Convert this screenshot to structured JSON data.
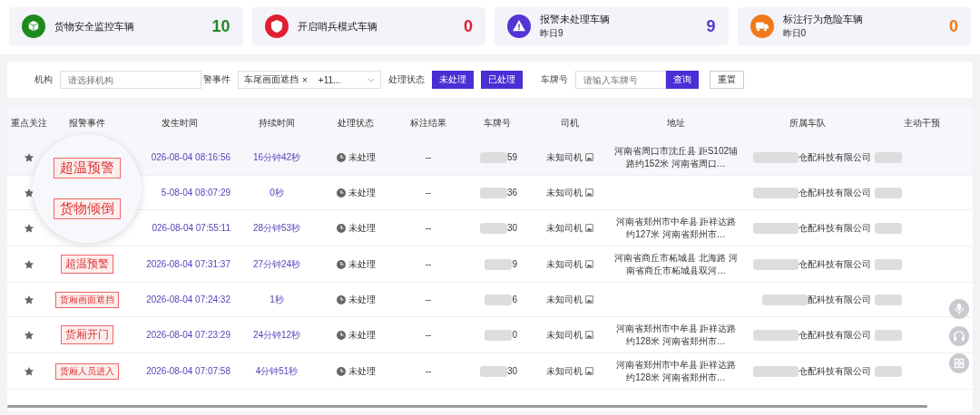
{
  "stat_cards": [
    {
      "color": "#1e8a1e",
      "title": "货物安全监控车辆",
      "value": "10"
    },
    {
      "color": "#e02030",
      "title": "开启哨兵模式车辆",
      "value": "0"
    },
    {
      "color": "#5335d6",
      "title": "报警未处理车辆",
      "sub": "昨日9",
      "value": "9"
    },
    {
      "color": "#f07a1a",
      "title": "标注行为危险车辆",
      "sub": "昨日0",
      "value": "0"
    }
  ],
  "filters": {
    "org_label": "机构",
    "org_placeholder": "请选择机构",
    "event_label": "警事件",
    "event_tag": "车尾画面遮挡",
    "event_tag_remove": "×",
    "event_more": "+11...",
    "status_label": "处理状态",
    "status_buttons": [
      {
        "label": "未处理",
        "selected": true
      },
      {
        "label": "已处理",
        "selected": true
      }
    ],
    "plate_label": "车牌号",
    "plate_placeholder": "请输入车牌号",
    "search": "查询",
    "reset": "重置"
  },
  "table": {
    "columns": [
      "重点关注",
      "报警事件",
      "发生时间",
      "持续时间",
      "处理状态",
      "标注结果",
      "车牌号",
      "司机",
      "地址",
      "所属车队",
      "主动干预"
    ],
    "rows": [
      {
        "time": "026-08-04 08:16:56",
        "duration": "16分钟42秒",
        "status": "未处理",
        "mark": "--",
        "plate": "59",
        "driver": "未知司机",
        "address": "河南省周口市沈丘县 距S102辅路约152米 河南省周口…",
        "fleet": "仓配科技有限公司"
      },
      {
        "time": "5-08-04 08:07:29",
        "duration": "0秒",
        "status": "未处理",
        "mark": "--",
        "plate": "36",
        "driver": "未知司机",
        "fleet": "仓配科技有限公司"
      },
      {
        "time": "026-08-04 07:55:11",
        "duration": "28分钟53秒",
        "status": "未处理",
        "mark": "--",
        "plate": "30",
        "driver": "未知司机",
        "address": "河南省郑州市中牟县 距祥达路约127米 河南省郑州市…",
        "fleet": "仓配科技有限公司"
      },
      {
        "event": "超温预警",
        "kind": "large",
        "time": "2026-08-04 07:31:37",
        "duration": "27分钟24秒",
        "status": "未处理",
        "mark": "--",
        "plate": "9",
        "driver": "未知司机",
        "address": "河南省商丘市柘城县 北海路 河南省商丘市柘城县双河…",
        "fleet": "仓配科技有限公司"
      },
      {
        "event": "货厢画面遮挡",
        "kind": "small",
        "time": "2026-08-04 07:24:32",
        "duration": "1秒",
        "status": "未处理",
        "mark": "--",
        "plate": "6",
        "driver": "未知司机",
        "fleet": "配科技有限公司"
      },
      {
        "event": "货厢开门",
        "kind": "large",
        "time": "2026-08-04 07:23:29",
        "duration": "24分钟12秒",
        "status": "未处理",
        "mark": "--",
        "plate": "0",
        "driver": "未知司机",
        "address": "河南省郑州市中牟县 距祥达路约128米 河南省郑州市…",
        "fleet": "仓配科技有限公司"
      },
      {
        "event": "货厢人员进入",
        "kind": "small",
        "time": "2026-08-04 07:07:58",
        "duration": "4分钟51秒",
        "status": "未处理",
        "mark": "--",
        "plate": "30",
        "driver": "未知司机",
        "address": "河南省郑州市中牟县 距祥达路约128米 河南省郑州市…",
        "fleet": "仓配科技有限公司"
      }
    ]
  },
  "magnifier": {
    "tags": [
      "超温预警",
      "货物倾倒"
    ]
  }
}
